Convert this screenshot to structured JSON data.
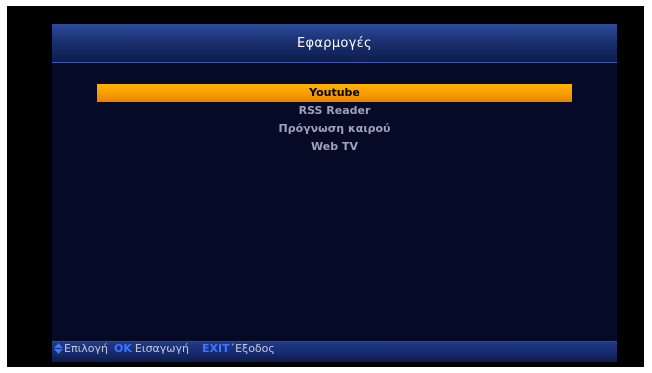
{
  "header": {
    "title": "Εφαρμογές"
  },
  "menu": {
    "items": [
      {
        "label": "Youtube"
      },
      {
        "label": "RSS Reader"
      },
      {
        "label": "Πρόγνωση καιρού"
      },
      {
        "label": "Web TV"
      }
    ],
    "selected_index": 0
  },
  "footer": {
    "hints": [
      {
        "icon": "up-down-arrows-icon",
        "label": "Επιλογή"
      },
      {
        "key": "OK",
        "label": "Εισαγωγή"
      },
      {
        "key": "EXIT",
        "label": "΄Εξοδος"
      }
    ]
  },
  "colors": {
    "panel_bg": "#050a26",
    "header_blue": "#1a3070",
    "selection_orange": "#f79a00",
    "key_blue": "#3a74ff",
    "item_text": "#9ea3b8"
  }
}
